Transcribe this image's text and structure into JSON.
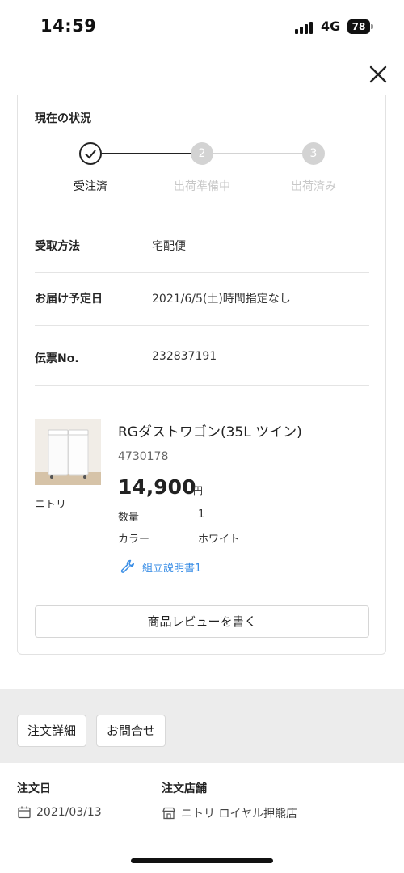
{
  "status_bar": {
    "time": "14:59",
    "network": "4G",
    "battery": "78"
  },
  "order_status": {
    "title": "現在の状況",
    "steps": [
      {
        "num": "",
        "label": "受注済",
        "state": "done"
      },
      {
        "num": "2",
        "label": "出荷準備中",
        "state": "todo"
      },
      {
        "num": "3",
        "label": "出荷済み",
        "state": "todo"
      }
    ]
  },
  "info": {
    "receive_method_label": "受取方法",
    "receive_method_value": "宅配便",
    "delivery_date_label": "お届け予定日",
    "delivery_date_value": "2021/6/5(土)時間指定なし",
    "slip_no_label": "伝票No.",
    "slip_no_value": "232837191"
  },
  "product": {
    "brand": "ニトリ",
    "name": "RGダストワゴン(35L ツイン)",
    "code": "4730178",
    "price": "14,900",
    "price_unit": "円",
    "quantity_label": "数量",
    "quantity_value": "1",
    "color_label": "カラー",
    "color_value": "ホワイト",
    "manual_link": "組立説明書1"
  },
  "review_button": "商品レビューを書く",
  "tabs": {
    "order_detail": "注文詳細",
    "inquiry": "お問合せ"
  },
  "footer": {
    "order_date_label": "注文日",
    "order_date_value": "2021/03/13",
    "store_label": "注文店舗",
    "store_value": "ニトリ ロイヤル押熊店"
  },
  "colors": {
    "accent_link": "#3a8ee6",
    "inactive_step": "#d3d3d3",
    "gray_bar": "#ececec"
  }
}
